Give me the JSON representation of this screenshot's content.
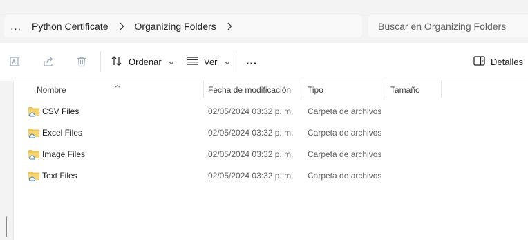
{
  "breadcrumb": {
    "overflow": "...",
    "items": [
      "Python Certificate",
      "Organizing Folders"
    ]
  },
  "search": {
    "placeholder": "Buscar en Organizing Folders"
  },
  "toolbar": {
    "sort_label": "Ordenar",
    "view_label": "Ver",
    "more_label": "...",
    "details_label": "Detalles"
  },
  "columns": {
    "name": "Nombre",
    "modified": "Fecha de modificación",
    "type": "Tipo",
    "size": "Tamaño"
  },
  "files": [
    {
      "name": "CSV Files",
      "modified": "02/05/2024 03:32 p. m.",
      "type": "Carpeta de archivos",
      "size": ""
    },
    {
      "name": "Excel Files",
      "modified": "02/05/2024 03:32 p. m.",
      "type": "Carpeta de archivos",
      "size": ""
    },
    {
      "name": "Image Files",
      "modified": "02/05/2024 03:32 p. m.",
      "type": "Carpeta de archivos",
      "size": ""
    },
    {
      "name": "Text Files",
      "modified": "02/05/2024 03:32 p. m.",
      "type": "Carpeta de archivos",
      "size": ""
    }
  ],
  "icons": {
    "rename": "rename-icon",
    "share": "share-icon",
    "delete": "delete-icon",
    "sort": "sort-icon",
    "view": "view-list-icon",
    "details": "details-pane-icon",
    "folder": "folder-cloud-icon"
  },
  "colors": {
    "folder_yellow": "#f2c14e",
    "cloud_blue": "#3b82c4",
    "chrome_bg": "#f3f3f3"
  }
}
